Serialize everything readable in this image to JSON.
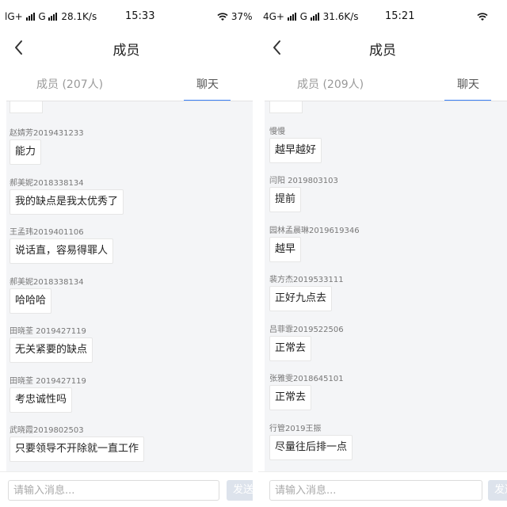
{
  "left": {
    "status": {
      "network": "lG+",
      "network2": "G",
      "speed": "28.1K/s",
      "time": "15:33",
      "battery": "37%"
    },
    "title": "成员",
    "tabs": {
      "members": "成员 (207人)",
      "chat": "聊天"
    },
    "messages": [
      {
        "sender": "赵婧芳2019431233",
        "text": "能力"
      },
      {
        "sender": "郝美妮2018338134",
        "text": "我的缺点是我太优秀了"
      },
      {
        "sender": "王孟玮2019401106",
        "text": "说话直，容易得罪人"
      },
      {
        "sender": "郝美妮2018338134",
        "text": "哈哈哈"
      },
      {
        "sender": "田晓荃 2019427119",
        "text": "无关紧要的缺点"
      },
      {
        "sender": "田晓荃 2019427119",
        "text": "考忠诚性吗"
      },
      {
        "sender": "武晓霞2019802503",
        "text": "只要领导不开除就一直工作"
      }
    ],
    "input_placeholder": "请输入消息...",
    "send_label": "发送"
  },
  "right": {
    "status": {
      "network": "4G+",
      "network2": "G",
      "speed": "31.6K/s",
      "time": "15:21"
    },
    "title": "成员",
    "tabs": {
      "members": "成员 (209人)",
      "chat": "聊天"
    },
    "messages": [
      {
        "sender": "慢慢",
        "text": "越早越好"
      },
      {
        "sender": "闫阳 2019803103",
        "text": "提前"
      },
      {
        "sender": "园林孟晨琳2019619346",
        "text": "越早"
      },
      {
        "sender": "裴方杰2019533111",
        "text": "正好九点去"
      },
      {
        "sender": "吕菲霏2019522506",
        "text": "正常去"
      },
      {
        "sender": "张雅雯2018645101",
        "text": "正常去"
      },
      {
        "sender": "行管2019王振",
        "text": "尽量往后排一点"
      }
    ],
    "input_placeholder": "请输入消息...",
    "send_label": "发送"
  },
  "colors": {
    "accent": "#3a7ff6",
    "chat_bg": "#f4f5f7"
  }
}
